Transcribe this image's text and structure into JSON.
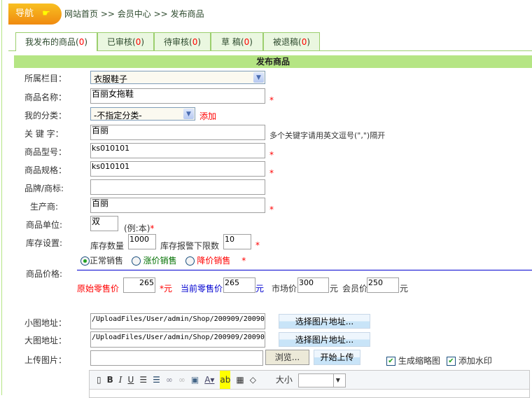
{
  "nav": {
    "label": "导航",
    "icon": "pointing-hand-icon"
  },
  "breadcrumb": [
    "网站首页",
    ">>",
    "会员中心",
    ">>",
    "发布商品"
  ],
  "tabs": [
    {
      "label": "我发布的商品",
      "count": "0"
    },
    {
      "label": "已审核",
      "count": "0"
    },
    {
      "label": "待审核",
      "count": "0"
    },
    {
      "label": "草 稿",
      "count": "0"
    },
    {
      "label": "被退稿",
      "count": "0"
    }
  ],
  "form": {
    "title": "发布商品",
    "category": {
      "label": "所属栏目：",
      "value": "衣服鞋子"
    },
    "name": {
      "label": "商品名称：",
      "value": "百丽女拖鞋"
    },
    "my_category": {
      "label": "我的分类：",
      "value": "-不指定分类-",
      "add": "添加"
    },
    "keywords": {
      "label": "关 键 字：",
      "value": "百丽",
      "hint": "多个关键字请用英文逗号(\",\")隔开"
    },
    "model": {
      "label": "商品型号：",
      "value": "ks010101"
    },
    "spec": {
      "label": "商品规格：",
      "value": "ks010101"
    },
    "brand": {
      "label": "品牌/商标:",
      "value": ""
    },
    "maker": {
      "label": "生产商:",
      "value": "百丽"
    },
    "unit": {
      "label": "商品单位:",
      "value": "双",
      "hint": "(例:本)"
    },
    "stock": {
      "label": "库存设置:",
      "qty_label": "库存数量",
      "qty": "1000",
      "alarm_label": "库存报警下限数",
      "alarm": "10"
    },
    "price": {
      "label": "商品价格:",
      "modes": [
        "正常销售",
        "涨价销售",
        "降价销售"
      ],
      "original_label": "原始零售价",
      "original": "265",
      "original_unit": "*元",
      "current_label": "当前零售价",
      "current": "265",
      "unit": "元",
      "market_label": "市场价",
      "market": "300",
      "member_label": "会员价",
      "member": "250"
    },
    "small_img": {
      "label": "小图地址：",
      "value": "/UploadFiles/User/admin/Shop/200909/200909",
      "button": "选择图片地址..."
    },
    "big_img": {
      "label": "大图地址：",
      "value": "/UploadFiles/User/admin/Shop/200909/200909",
      "button": "选择图片地址..."
    },
    "upload": {
      "label": "上传图片：",
      "browse": "浏览...",
      "start": "开始上传",
      "thumb": "生成缩略图",
      "watermark": "添加水印"
    },
    "required": "*"
  },
  "editor": {
    "size_label": "大小",
    "tools": [
      "new-doc-icon",
      "bold-icon",
      "italic-icon",
      "underline-icon",
      "ordered-list-icon",
      "unordered-list-icon",
      "link-icon",
      "unlink-icon",
      "image-icon",
      "font-color-icon",
      "highlight-icon",
      "table-icon",
      "eraser-icon"
    ]
  }
}
